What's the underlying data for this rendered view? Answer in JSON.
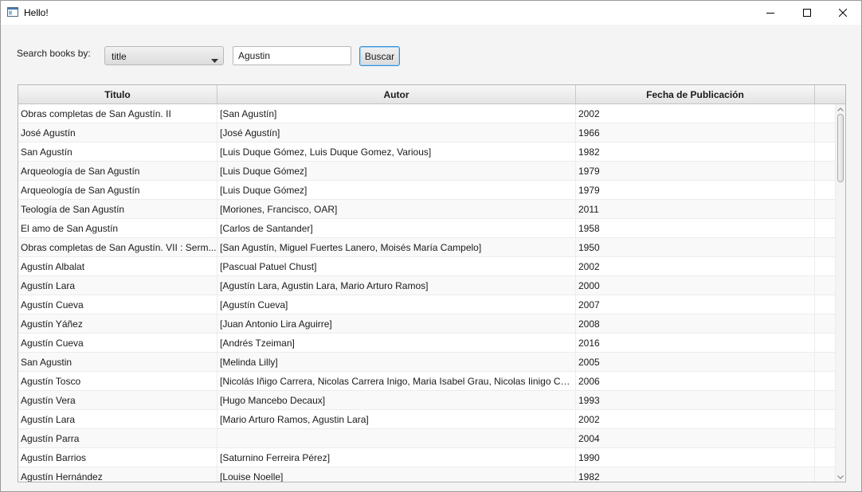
{
  "window": {
    "title": "Hello!"
  },
  "search": {
    "label": "Search books by:",
    "field_selected": "title",
    "query_value": "Agustin",
    "button_label": "Buscar"
  },
  "table": {
    "columns": [
      "Titulo",
      "Autor",
      "Fecha de Publicación"
    ],
    "rows": [
      {
        "title": "Obras completas de San Agustín. II",
        "author": "[San Agustín]",
        "date": "2002"
      },
      {
        "title": "José Agustín",
        "author": "[José Agustín]",
        "date": "1966"
      },
      {
        "title": "San Agustín",
        "author": "[Luis Duque Gómez, Luis Duque Gomez, Various]",
        "date": "1982"
      },
      {
        "title": "Arqueología de San Agustín",
        "author": "[Luis Duque Gómez]",
        "date": "1979"
      },
      {
        "title": "Arqueología de San Agustín",
        "author": "[Luis Duque Gómez]",
        "date": "1979"
      },
      {
        "title": "Teología de San Agustín",
        "author": "[Moriones, Francisco, OAR]",
        "date": "2011"
      },
      {
        "title": "El amo de San Agustín",
        "author": "[Carlos de Santander]",
        "date": "1958"
      },
      {
        "title": "Obras completas de San Agustín. VII : Serm...",
        "author": "[San Agustín, Miguel Fuertes Lanero, Moisés María Campelo]",
        "date": "1950"
      },
      {
        "title": "Agustín Albalat",
        "author": "[Pascual Patuel Chust]",
        "date": "2002"
      },
      {
        "title": "Agustín Lara",
        "author": "[Agustín Lara, Agustin Lara, Mario Arturo Ramos]",
        "date": "2000"
      },
      {
        "title": "Agustín Cueva",
        "author": "[Agustín Cueva]",
        "date": "2007"
      },
      {
        "title": "Agustín Yáñez",
        "author": "[Juan Antonio Lira Aguirre]",
        "date": "2008"
      },
      {
        "title": "Agustín Cueva",
        "author": "[Andrés Tzeiman]",
        "date": "2016"
      },
      {
        "title": "San Agustin",
        "author": "[Melinda Lilly]",
        "date": "2005"
      },
      {
        "title": "Agustín Tosco",
        "author": "[Nicolás Iñigo Carrera, Nicolas Carrera Inigo, Maria Isabel Grau, Nicolas Iinigo Carr...",
        "date": "2006"
      },
      {
        "title": "Agustín Vera",
        "author": "[Hugo Mancebo Decaux]",
        "date": "1993"
      },
      {
        "title": "Agustín Lara",
        "author": "[Mario Arturo Ramos, Agustin Lara]",
        "date": "2002"
      },
      {
        "title": "Agustín Parra",
        "author": "",
        "date": "2004"
      },
      {
        "title": "Agustín Barrios",
        "author": "[Saturnino Ferreira Pérez]",
        "date": "1990"
      },
      {
        "title": "Agustín Hernández",
        "author": "[Louise Noelle]",
        "date": "1982"
      }
    ]
  },
  "icons": {
    "app": "app-window-icon",
    "minimize": "minimize-icon",
    "maximize": "maximize-icon",
    "close": "close-icon",
    "combo_arrow": "chevron-down-icon",
    "scroll_up": "scroll-up-arrow-icon",
    "scroll_down": "scroll-down-arrow-icon"
  },
  "colors": {
    "focus_border": "#2f90d8",
    "window_bg": "#f4f4f4",
    "header_bg": "#e4e4e4"
  }
}
